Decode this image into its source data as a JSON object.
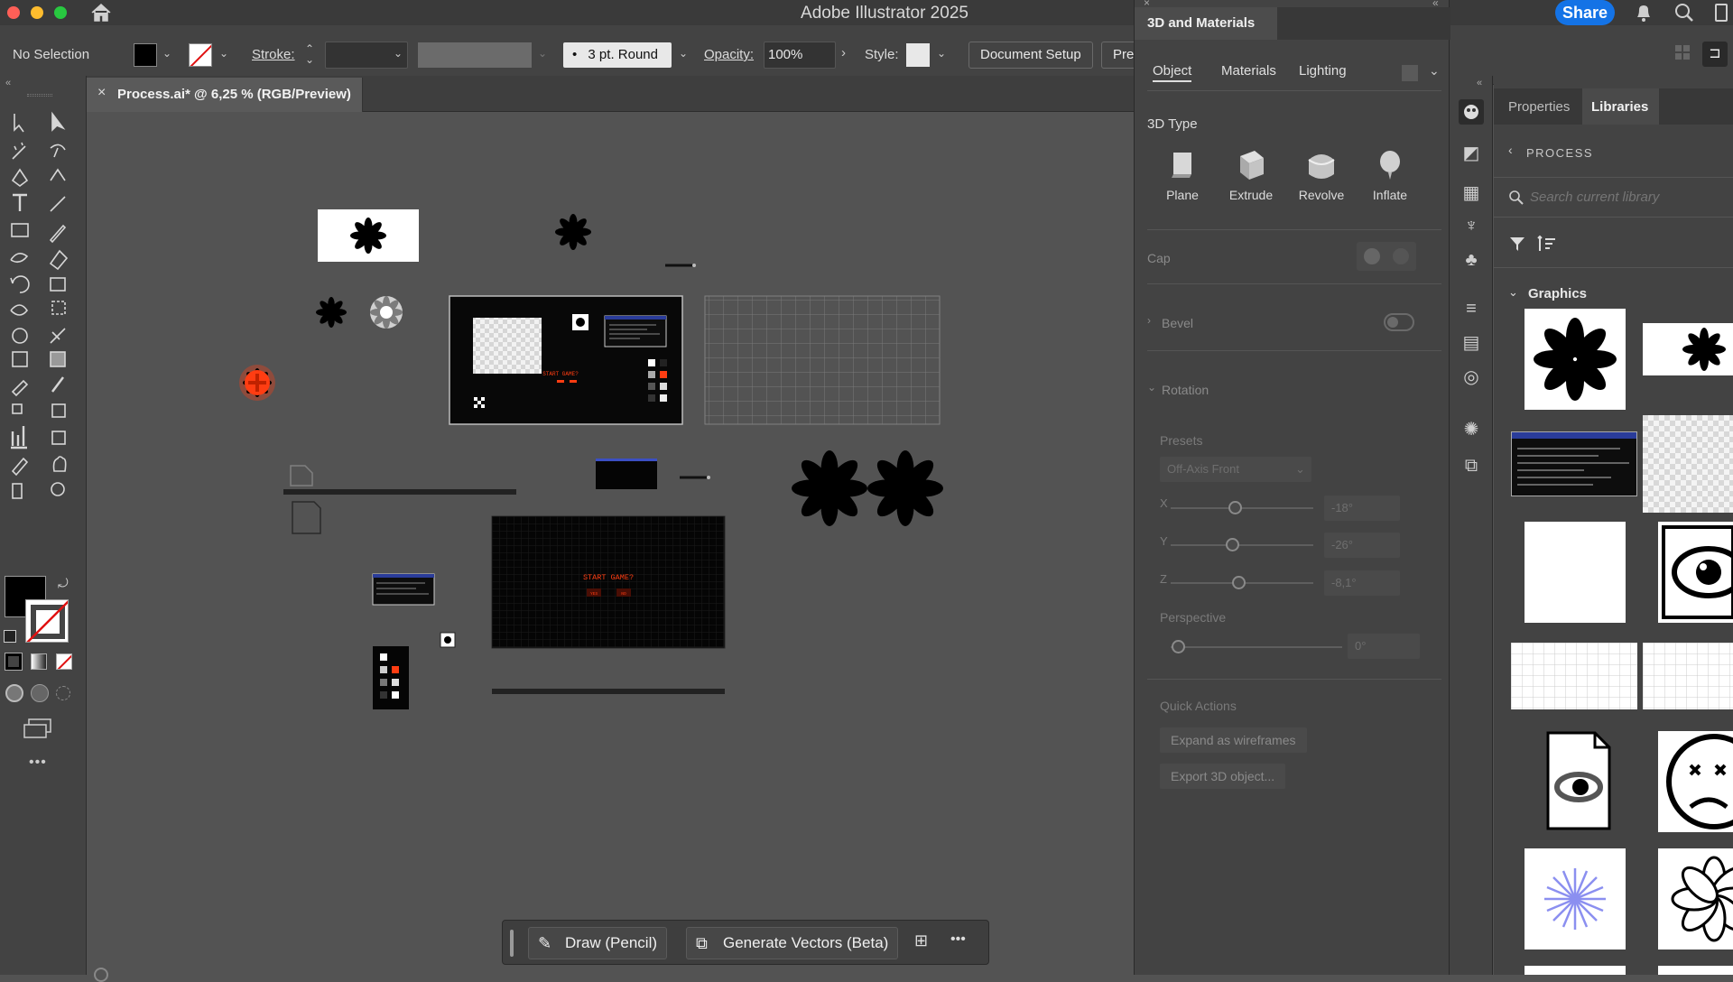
{
  "window": {
    "title": "Adobe Illustrator 2025",
    "share_label": "Share"
  },
  "control_bar": {
    "selection": "No Selection",
    "stroke_label": "Stroke:",
    "brush": "3 pt. Round",
    "opacity_label": "Opacity:",
    "opacity_value": "100%",
    "style_label": "Style:",
    "document_setup": "Document Setup",
    "prefs": "Pref"
  },
  "document_tab": {
    "close": "×",
    "label": "Process.ai* @ 6,25 % (RGB/Preview)"
  },
  "canvas": {
    "dialog_text": "START GAME?",
    "yes": "YES",
    "no": "NO"
  },
  "panel_3d": {
    "title": "3D and Materials",
    "tabs": [
      "Object",
      "Materials",
      "Lighting"
    ],
    "active_tab": "Object",
    "type_heading": "3D Type",
    "types": [
      "Plane",
      "Extrude",
      "Revolve",
      "Inflate"
    ],
    "cap_label": "Cap",
    "bevel_label": "Bevel",
    "rotation_label": "Rotation",
    "presets_label": "Presets",
    "preset_value": "Off-Axis Front",
    "axes": [
      {
        "axis": "X",
        "value": "-18°"
      },
      {
        "axis": "Y",
        "value": "-26°"
      },
      {
        "axis": "Z",
        "value": "-8,1°"
      }
    ],
    "perspective_label": "Perspective",
    "perspective_value": "0°",
    "quick_actions_label": "Quick Actions",
    "quick_actions": [
      "Expand as wireframes",
      "Export 3D object..."
    ]
  },
  "libraries": {
    "tabs": [
      "Properties",
      "Libraries"
    ],
    "active_tab": "Libraries",
    "breadcrumb": "PROCESS",
    "search_placeholder": "Search current library",
    "section": "Graphics"
  },
  "floating_bar": {
    "draw_label": "Draw (Pencil)",
    "generate_label": "Generate Vectors (Beta)",
    "more": "•••"
  },
  "colors": {
    "accent": "#1473e6",
    "orange": "#ff3d12",
    "panel_bg": "#434343",
    "canvas_bg": "#535353"
  }
}
